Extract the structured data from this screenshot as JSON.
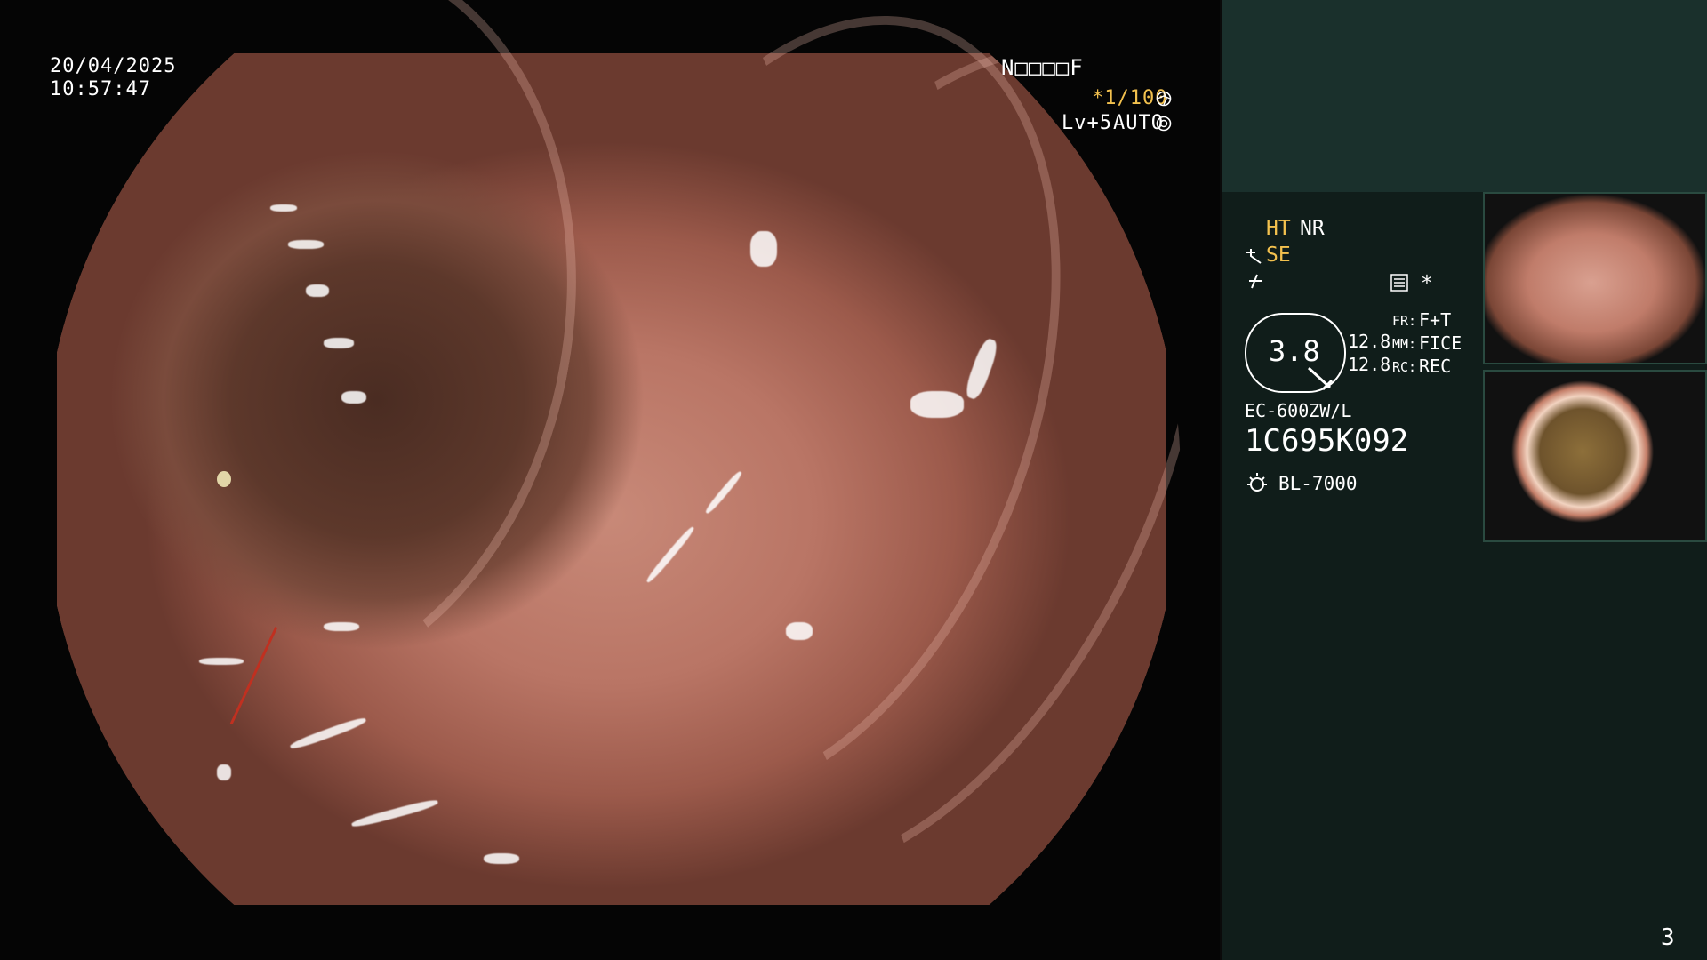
{
  "overlay": {
    "date": "20/04/2025",
    "time": "10:57:47",
    "patient_code": "N□□□□F",
    "shutter": "*1/100",
    "level": "Lv+5",
    "exposure_mode": "AUTO"
  },
  "panel": {
    "ht": "HT",
    "nr": "NR",
    "se": "SE",
    "asterisk": "*",
    "zoom": "3.8",
    "fr_label": "FR:",
    "fr_value": "F+T",
    "mm_label": "MM:",
    "mm_value": "FICE",
    "rc_label": "RC:",
    "rc_value": "REC",
    "val1": "12.8",
    "val2": "12.8",
    "scope_model": "EC-600ZW/L",
    "serial": "1C695K092",
    "light_source": "BL-7000",
    "page_number": "3"
  },
  "icons": {
    "shutter_icon": "aperture-icon",
    "auto_icon": "iris-icon",
    "structure_icon": "structure-enhance-icon",
    "color_icon": "color-enhance-icon",
    "memo_icon": "memo-icon",
    "light_icon": "light-bulb-icon"
  },
  "colors": {
    "panel_bg": "#101d1a",
    "panel_top": "#1a302c",
    "accent_yellow": "#f3c14e"
  }
}
